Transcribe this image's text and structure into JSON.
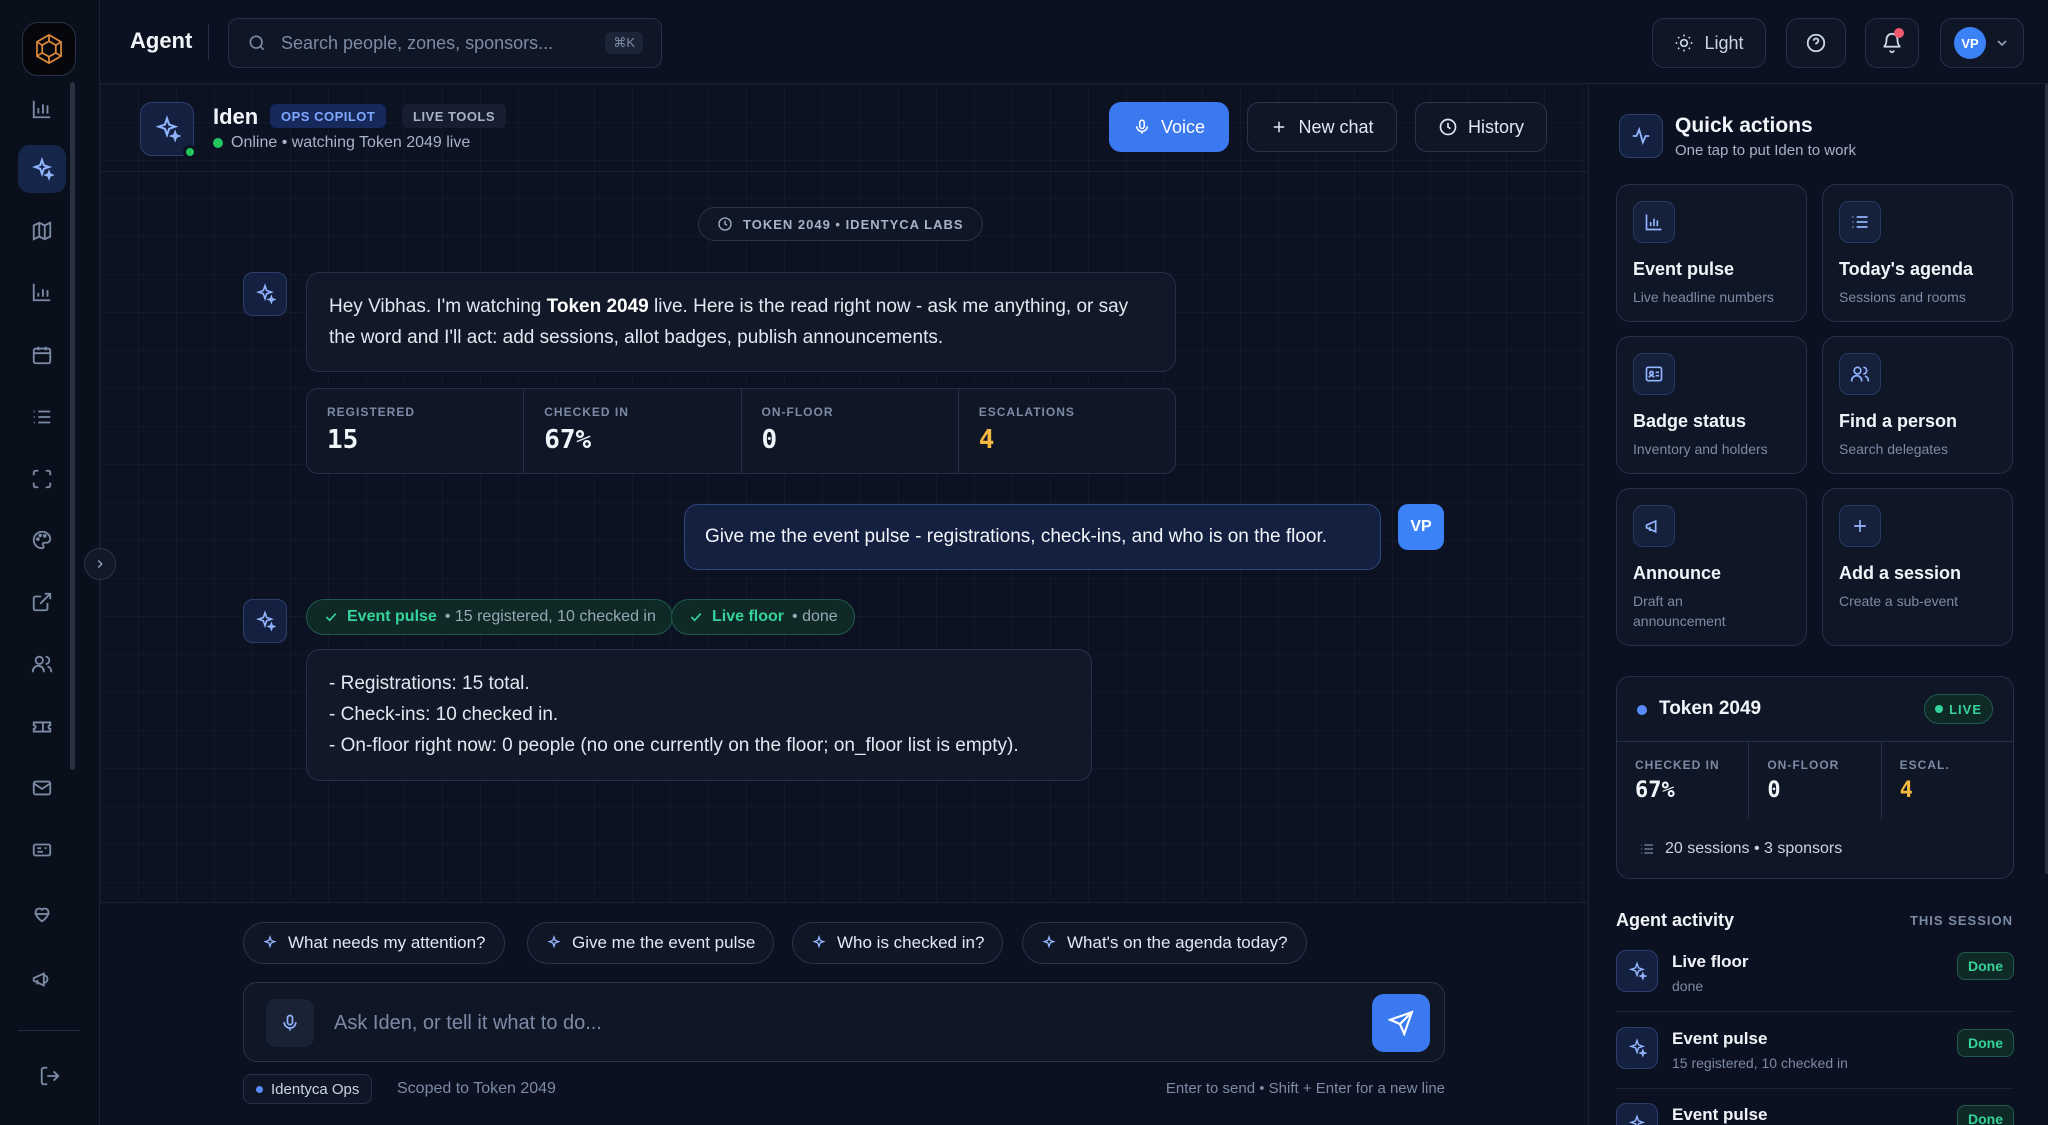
{
  "topbar": {
    "title": "Agent",
    "search_placeholder": "Search people, zones, sponsors...",
    "search_shortcut": "⌘K",
    "theme_label": "Light",
    "user_initials": "VP"
  },
  "agent": {
    "name": "Iden",
    "tags": [
      "OPS COPILOT",
      "LIVE TOOLS"
    ],
    "status": "Online • watching Token 2049 live"
  },
  "header_buttons": {
    "voice": "Voice",
    "new_chat": "New chat",
    "history": "History"
  },
  "session_pill": "TOKEN 2049 • IDENTYCA LABS",
  "messages": {
    "greeting_before": "Hey Vibhas. I'm watching ",
    "greeting_bold": "Token 2049",
    "greeting_after": " live. Here is the read right now - ask me anything, or say the word and I'll act: add sessions, allot badges, publish announcements.",
    "stats": [
      {
        "label": "REGISTERED",
        "value": "15"
      },
      {
        "label": "CHECKED IN",
        "value": "67%"
      },
      {
        "label": "ON-FLOOR",
        "value": "0"
      },
      {
        "label": "ESCALATIONS",
        "value": "4"
      }
    ],
    "user_message": "Give me the event pulse - registrations, check-ins, and who is on the floor.",
    "user_initials": "VP",
    "tool_chips": [
      {
        "name": "Event pulse",
        "detail": "• 15 registered, 10 checked in"
      },
      {
        "name": "Live floor",
        "detail": "• done"
      }
    ],
    "reply_lines": [
      "- Registrations: 15 total.",
      "- Check-ins: 10 checked in.",
      "- On-floor right now: 0 people (no one currently on the floor; on_floor list is empty)."
    ]
  },
  "suggestions": [
    "What needs my attention?",
    "Give me the event pulse",
    "Who is checked in?",
    "What's on the agenda today?"
  ],
  "composer": {
    "placeholder": "Ask Iden, or tell it what to do...",
    "org_tag": "Identyca Ops",
    "scope": "Scoped to Token 2049",
    "hint": "Enter to send • Shift + Enter for a new line"
  },
  "quick_actions": {
    "title": "Quick actions",
    "subtitle": "One tap to put Iden to work",
    "cards": [
      {
        "title": "Event pulse",
        "sub": "Live headline numbers",
        "icon": "bar-chart-icon"
      },
      {
        "title": "Today's agenda",
        "sub": "Sessions and rooms",
        "icon": "list-icon"
      },
      {
        "title": "Badge status",
        "sub": "Inventory and holders",
        "icon": "id-card-icon"
      },
      {
        "title": "Find a person",
        "sub": "Search delegates",
        "icon": "users-icon"
      },
      {
        "title": "Announce",
        "sub": "Draft an announcement",
        "icon": "megaphone-icon"
      },
      {
        "title": "Add a session",
        "sub": "Create a sub-event",
        "icon": "plus-icon"
      }
    ]
  },
  "live_event": {
    "name": "Token 2049",
    "badge": "LIVE",
    "stats": [
      {
        "label": "CHECKED IN",
        "value": "67%"
      },
      {
        "label": "ON-FLOOR",
        "value": "0"
      },
      {
        "label": "ESCAL.",
        "value": "4"
      }
    ],
    "footer": "20 sessions • 3 sponsors"
  },
  "activity": {
    "title": "Agent activity",
    "scope": "THIS SESSION",
    "items": [
      {
        "name": "Live floor",
        "detail": "done",
        "status": "Done"
      },
      {
        "name": "Event pulse",
        "detail": "15 registered, 10 checked in",
        "status": "Done"
      },
      {
        "name": "Event pulse",
        "detail": "",
        "status": "Done"
      }
    ]
  },
  "colors": {
    "accent": "#3b79f0",
    "success": "#34d399",
    "warning": "#f5b942",
    "background": "#0b1120"
  }
}
